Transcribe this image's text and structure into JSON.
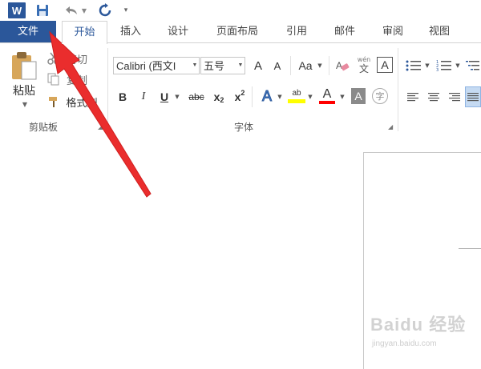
{
  "qat": {
    "app_logo": "W",
    "icons": [
      "word-logo-icon",
      "save-icon",
      "undo-icon",
      "redo-icon",
      "customize-qat-icon"
    ]
  },
  "tabs": [
    {
      "label": "文件",
      "active": false
    },
    {
      "label": "开始",
      "active": true
    },
    {
      "label": "插入"
    },
    {
      "label": "设计"
    },
    {
      "label": "页面布局"
    },
    {
      "label": "引用"
    },
    {
      "label": "邮件"
    },
    {
      "label": "审阅"
    },
    {
      "label": "视图"
    }
  ],
  "clipboard": {
    "paste_label": "粘贴",
    "cut_label": "剪切",
    "copy_label": "复制",
    "format_painter_label": "格式刷",
    "group_label": "剪贴板"
  },
  "font": {
    "font_name": "Calibri (西文I",
    "font_size": "五号",
    "grow_label": "A",
    "shrink_label": "A",
    "change_case_label": "Aa",
    "phonetic_top": "wén",
    "phonetic_bottom": "文",
    "char_border_label": "A",
    "bold": "B",
    "italic": "I",
    "underline": "U",
    "strike": "abc",
    "subscript_base": "x",
    "subscript_sub": "2",
    "superscript_base": "x",
    "superscript_sup": "2",
    "text_effect": "A",
    "highlight": "ab",
    "font_color": "A",
    "char_shading": "A",
    "enclose": "字",
    "group_label": "字体"
  },
  "colors": {
    "brand": "#2b579a",
    "highlight": "#ffff00",
    "font_color": "#ff0000",
    "arrow": "#ea2d2d"
  },
  "watermark": {
    "main": "Baidu 经验",
    "sub": "jingyan.baidu.com"
  }
}
